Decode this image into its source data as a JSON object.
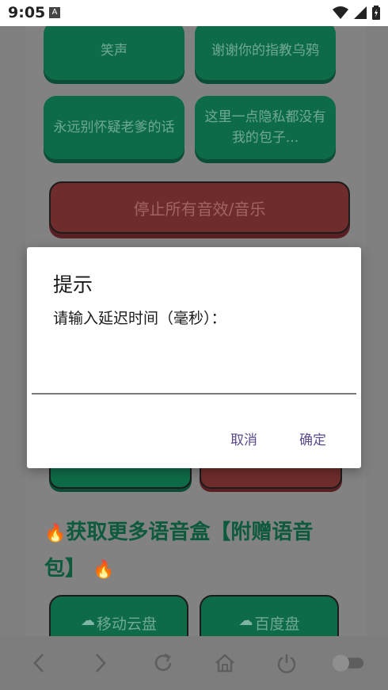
{
  "status_bar": {
    "time": "9:05",
    "notification_icon": "A"
  },
  "page": {
    "sound_buttons": [
      {
        "label": "笑声"
      },
      {
        "label": "谢谢你的指教乌鸦"
      },
      {
        "label": "永远别怀疑老爹的话"
      },
      {
        "label": "这里一点隐私都没有我的包子..."
      }
    ],
    "stop_button": "停止所有音效/音乐",
    "promo_title": "获取更多语音盒【附赠语音包】",
    "fire_icon_left": "🔥",
    "fire_icon_right": "🔥",
    "cloud_buttons": [
      {
        "label": "移动云盘"
      },
      {
        "label": "百度盘"
      }
    ]
  },
  "dialog": {
    "title": "提示",
    "message": "请输入延迟时间（毫秒）：",
    "input_value": "",
    "cancel_label": "取消",
    "confirm_label": "确定"
  },
  "colors": {
    "accent_green": "#0e6b47",
    "stop_red": "#6f2c2c",
    "dialog_button": "#5b4a8c"
  }
}
